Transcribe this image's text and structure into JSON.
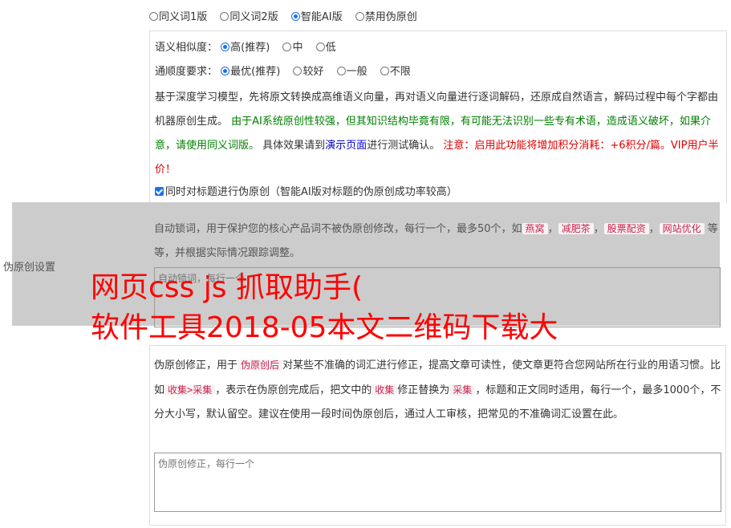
{
  "mode_options": [
    {
      "label": "同义词1版",
      "selected": false
    },
    {
      "label": "同义词2版",
      "selected": false
    },
    {
      "label": "智能AI版",
      "selected": true
    },
    {
      "label": "禁用伪原创",
      "selected": false
    }
  ],
  "similarity": {
    "label": "语义相似度：",
    "options": [
      {
        "label": "高(推荐)",
        "selected": true
      },
      {
        "label": "中",
        "selected": false
      },
      {
        "label": "低",
        "selected": false
      }
    ]
  },
  "fluency": {
    "label": "通顺度要求：",
    "options": [
      {
        "label": "最优(推荐)",
        "selected": true
      },
      {
        "label": "较好",
        "selected": false
      },
      {
        "label": "一般",
        "selected": false
      },
      {
        "label": "不限",
        "selected": false
      }
    ]
  },
  "ai_description": {
    "p1": "基于深度学习模型，先将原文转换成高维语义向量，再对语义向量进行逐词解码，还原成自然语言，解码过程中每个字都由机器原创生成。",
    "p2_green_a": "由于AI系统原创性较强，但其知识结构毕竟有限，有可能无法识别一些专有术语，造成语义破坏，如果介意，请使用同义词版。",
    "p3": "具体效果请到",
    "p3_link": "演示页面",
    "p3_end": "进行测试确认。",
    "p4_red": "注意：启用此功能将增加积分消耗：+6积分/篇。VIP用户半价！"
  },
  "title_checkbox": {
    "label": "同时对标题进行伪原创（智能AI版对标题的伪原创成功率较高）",
    "checked": true
  },
  "section_label": "伪原创设置",
  "lock_words": {
    "desc_start": "自动锁词，用于保护您的核心产品词不被伪原创修改，每行一个，最多50个，如",
    "examples": [
      "燕窝",
      "减肥茶",
      "股票配资",
      "网站优化"
    ],
    "desc_end": "等等，并根据实际情况跟踪调整。",
    "placeholder": "自动锁词，每行一个"
  },
  "watermark": {
    "line1": "网页css js 抓取助手(",
    "line2": "软件工具2018-05本文二维码下载大"
  },
  "correction": {
    "t1": "伪原创修正，用于",
    "tag1": "伪原创后",
    "t2": "对某些不准确的词汇进行修正，提高文章可读性，使文章更符合您网站所在行业的用语习惯。比如",
    "tag2": "收集>采集",
    "t3": "，表示在伪原创完成后，把文中的",
    "tag3": "收集",
    "t4": "修正替换为",
    "tag4": "采集",
    "t5": "，标题和正文同时适用，每行一个，最多1000个，不分大小写，默认留空。建议在使用一段时间伪原创后，通过人工审核，把常见的不准确词汇设置在此。",
    "placeholder": "伪原创修正，每行一个"
  }
}
